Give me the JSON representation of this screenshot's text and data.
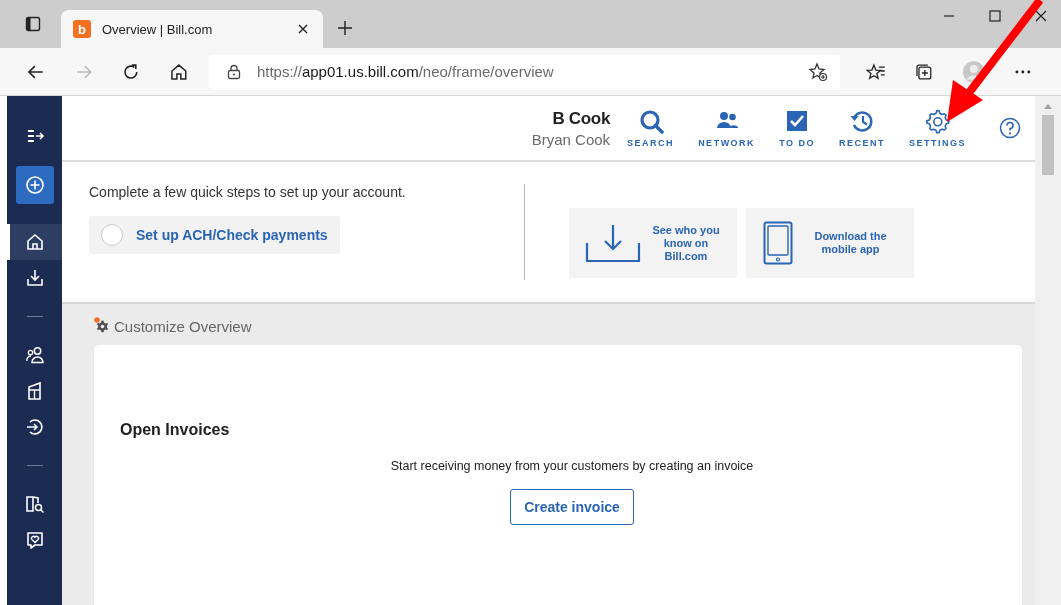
{
  "browser": {
    "tab": {
      "favicon": "b",
      "title": "Overview | Bill.com"
    },
    "url": {
      "scheme": "https://",
      "host": "app01.us.bill.com",
      "path": "/neo/frame/overview"
    }
  },
  "sidebar": {
    "items": [
      {
        "kind": "menu",
        "selected": false
      },
      {
        "kind": "add",
        "selected": false
      },
      {
        "kind": "divider-space"
      },
      {
        "kind": "home",
        "selected": true
      },
      {
        "kind": "inbox",
        "selected": false
      },
      {
        "kind": "divider"
      },
      {
        "kind": "contacts",
        "selected": false
      },
      {
        "kind": "building",
        "selected": false
      },
      {
        "kind": "signin",
        "selected": false
      },
      {
        "kind": "divider"
      },
      {
        "kind": "book-search",
        "selected": false
      },
      {
        "kind": "chat-heart",
        "selected": false
      }
    ]
  },
  "header": {
    "user": {
      "short_name": "B Cook",
      "full_name": "Bryan Cook"
    },
    "nav": [
      {
        "kind": "search",
        "label": "SEARCH"
      },
      {
        "kind": "network",
        "label": "NETWORK"
      },
      {
        "kind": "todo",
        "label": "TO DO"
      },
      {
        "kind": "recent",
        "label": "RECENT"
      },
      {
        "kind": "settings",
        "label": "SETTINGS"
      }
    ]
  },
  "setup": {
    "intro": "Complete a few quick steps to set up your account.",
    "steps": [
      {
        "label": "Set up ACH/Check payments",
        "checked": false
      }
    ],
    "tiles": [
      {
        "kind": "download",
        "label": "See who you know on Bill.com"
      },
      {
        "kind": "phone",
        "label": "Download the mobile app"
      }
    ]
  },
  "customize": {
    "label": "Customize Overview",
    "notification": true
  },
  "open_invoices": {
    "title": "Open Invoices",
    "message": "Start receiving money from your customers by creating an invoice",
    "button": "Create invoice"
  },
  "annotation_arrow": true
}
